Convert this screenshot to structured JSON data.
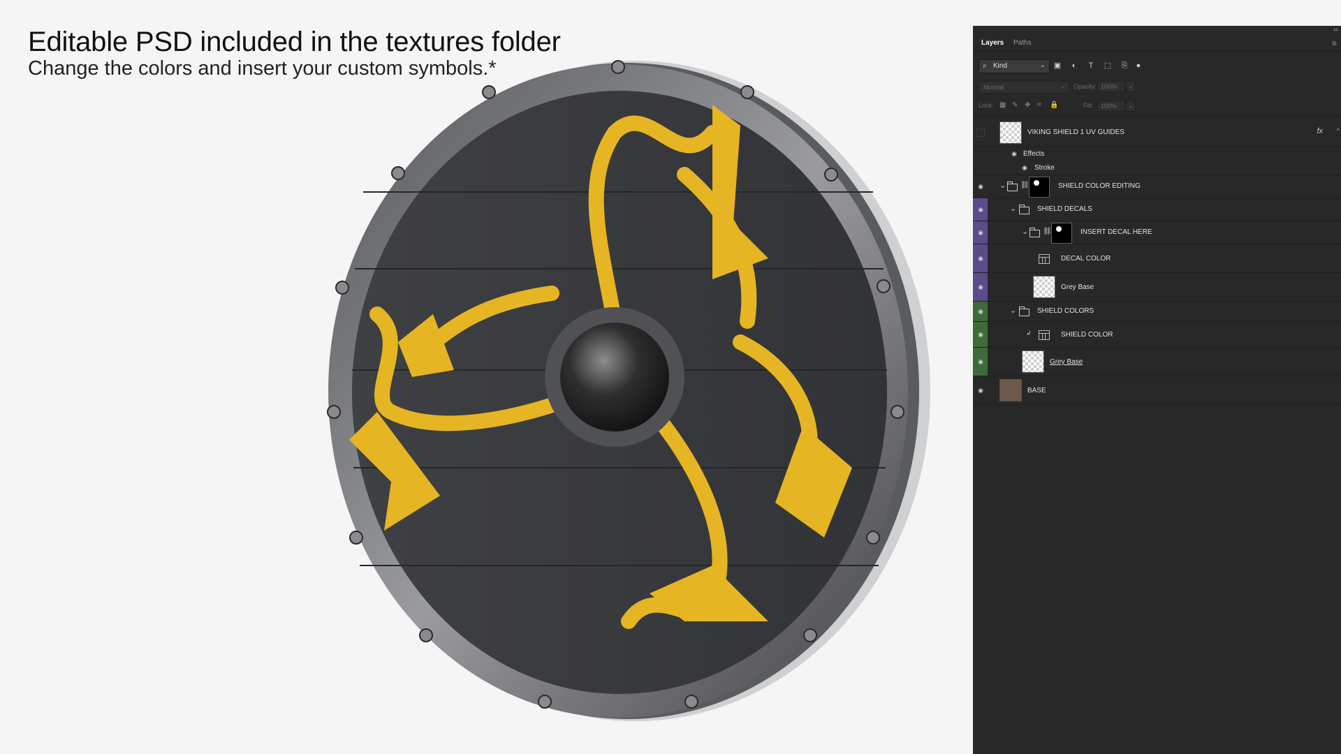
{
  "headline": "Editable PSD included in the textures folder",
  "subline": "Change the colors and insert your custom symbols.*",
  "panel": {
    "tabs": [
      "Layers",
      "Paths"
    ],
    "filter": {
      "kind_label": "Kind",
      "icons": [
        "image-filter-icon",
        "adjustment-filter-icon",
        "type-filter-icon",
        "shape-filter-icon",
        "smart-object-filter-icon",
        "filter-toggle-icon"
      ]
    },
    "blend_mode": "Normal",
    "opacity_label": "Opacity:",
    "opacity_value": "100%",
    "lock_label": "Lock:",
    "fill_label": "Fill:",
    "fill_value": "100%",
    "layers": [
      {
        "name": "VIKING SHIELD 1 UV GUIDES",
        "visible": false,
        "fx": "fx"
      },
      {
        "name": "Effects",
        "visible": true
      },
      {
        "name": "Stroke",
        "visible": true
      },
      {
        "name": "SHIELD COLOR EDITING",
        "visible": true
      },
      {
        "name": "SHIELD DECALS",
        "visible": true,
        "color": "#5b4b8a"
      },
      {
        "name": "INSERT DECAL HERE",
        "visible": true,
        "color": "#5b4b8a"
      },
      {
        "name": "DECAL COLOR",
        "visible": true,
        "color": "#5b4b8a"
      },
      {
        "name": "Grey Base",
        "visible": true,
        "color": "#5b4b8a"
      },
      {
        "name": "SHIELD COLORS",
        "visible": true,
        "color": "#3f6b3a"
      },
      {
        "name": "SHIELD COLOR",
        "visible": true,
        "color": "#3f6b3a"
      },
      {
        "name": "Grey Base",
        "visible": true,
        "color": "#3f6b3a"
      },
      {
        "name": "BASE",
        "visible": true
      }
    ]
  },
  "colors": {
    "decal": "#e6b523",
    "wood": "#3a3b3e",
    "metal": "#6e6f72",
    "panel_bg": "#282828",
    "purple_tag": "#5b4b8a",
    "green_tag": "#3f6b3a"
  }
}
